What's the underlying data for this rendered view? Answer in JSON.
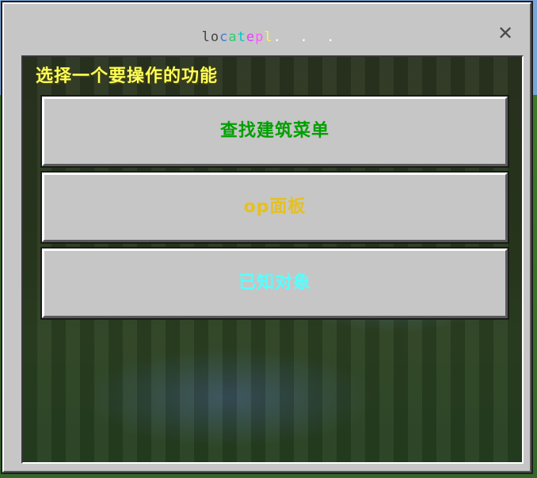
{
  "dialog": {
    "title_chars": [
      {
        "ch": "l",
        "color": "#444444"
      },
      {
        "ch": "o",
        "color": "#444444"
      },
      {
        "ch": "c",
        "color": "#3a7bd5"
      },
      {
        "ch": "a",
        "color": "#2ecc71"
      },
      {
        "ch": "t",
        "color": "#00c8c8"
      },
      {
        "ch": "e",
        "color": "#e040fb"
      },
      {
        "ch": "p",
        "color": "#ff55ff"
      },
      {
        "ch": "l",
        "color": "#ffee66"
      },
      {
        "ch": ".",
        "color": "#ffffff"
      },
      {
        "ch": " ",
        "color": "#ffffff"
      },
      {
        "ch": " ",
        "color": "#ffffff"
      },
      {
        "ch": ".",
        "color": "#ffffff"
      },
      {
        "ch": " ",
        "color": "#ffffff"
      },
      {
        "ch": " ",
        "color": "#ffffff"
      },
      {
        "ch": ".",
        "color": "#ffffff"
      }
    ],
    "close_glyph": "✕",
    "prompt": "选择一个要操作的功能",
    "prompt_color": "#ffff55"
  },
  "buttons": [
    {
      "label": "查找建筑菜单",
      "color": "#00a000"
    },
    {
      "label": "op面板",
      "color": "#e6c020"
    },
    {
      "label": "已知对象",
      "color": "#55ffff"
    }
  ]
}
